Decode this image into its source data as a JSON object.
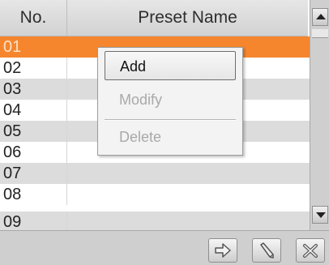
{
  "header": {
    "col_no": "No.",
    "col_name": "Preset Name"
  },
  "rows": [
    {
      "no": "01",
      "name": ""
    },
    {
      "no": "02",
      "name": ""
    },
    {
      "no": "03",
      "name": ""
    },
    {
      "no": "04",
      "name": ""
    },
    {
      "no": "05",
      "name": ""
    },
    {
      "no": "06",
      "name": ""
    },
    {
      "no": "07",
      "name": ""
    },
    {
      "no": "08",
      "name": ""
    },
    {
      "no": "09",
      "name": ""
    }
  ],
  "selected_row": "01",
  "context_menu": {
    "add": "Add",
    "modify": "Modify",
    "delete": "Delete"
  },
  "toolbar": {
    "icons": [
      "arrow-right-icon",
      "pencil-icon",
      "close-icon"
    ]
  },
  "colors": {
    "selection": "#f5862e",
    "row_alt": "#dcdcdc"
  }
}
